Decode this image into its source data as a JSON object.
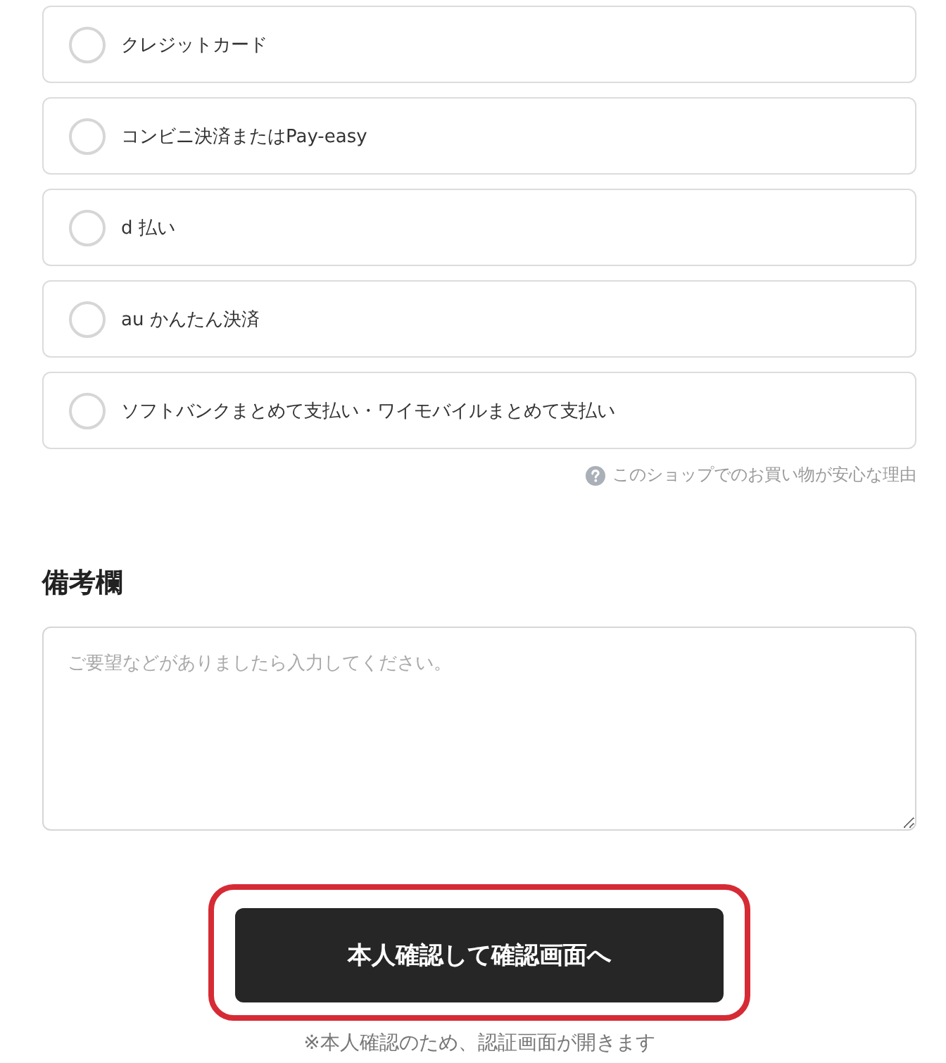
{
  "payment_methods": [
    {
      "label": "クレジットカード",
      "selected": false
    },
    {
      "label": "コンビニ決済またはPay-easy",
      "selected": false
    },
    {
      "label": "d 払い",
      "selected": false
    },
    {
      "label": "au かんたん決済",
      "selected": false
    },
    {
      "label": "ソフトバンクまとめて支払い・ワイモバイルまとめて支払い",
      "selected": false
    }
  ],
  "help_link": {
    "label": "このショップでのお買い物が安心な理由"
  },
  "remarks": {
    "heading": "備考欄",
    "placeholder": "ご要望などがありましたら入力してください。"
  },
  "submit": {
    "label": "本人確認して確認画面へ",
    "highlighted": true,
    "note": "※本人確認のため、認証画面が開きます"
  }
}
